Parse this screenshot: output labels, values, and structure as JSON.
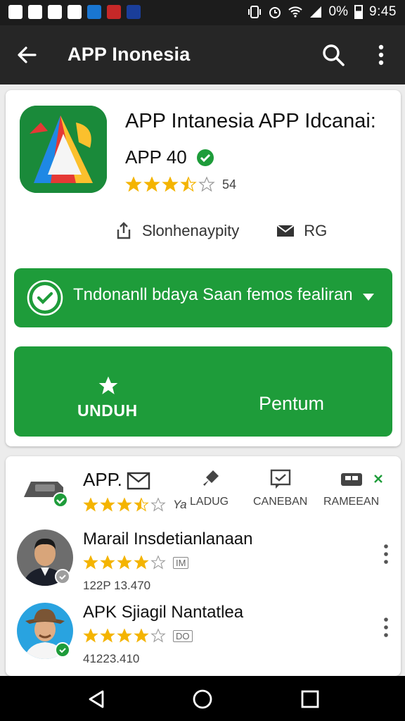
{
  "status_bar": {
    "battery_text": "0%",
    "time": "9:45"
  },
  "app_bar": {
    "title": "APP Inonesia"
  },
  "app": {
    "title": "APP Intanesia APP Idcanai:",
    "subtitle": "APP 40",
    "rating_stars": 3.5,
    "rating_count": "54",
    "meta_left": "Slonhenaypity",
    "meta_right": "RG"
  },
  "install_banner": {
    "text": "Tndonanll bdaya Saan femos fealiran"
  },
  "buttons": {
    "unduh": "UNDUH",
    "pentum": "Pentum"
  },
  "developer": {
    "title": "APP.",
    "rating_stars": 3.5,
    "rating_count": "Ya",
    "actions": [
      "LADUG",
      "CANEBAN",
      "RAMEEAN"
    ]
  },
  "reviews": [
    {
      "name": "Marail Insdetianlanaan",
      "stars": 4,
      "tag": "IM",
      "date": "122P 13.470"
    },
    {
      "name": "APK Sjiagil Nantatlea",
      "stars": 4,
      "tag": "DO",
      "date": "41223.410"
    }
  ],
  "colors": {
    "green": "#1e9c3a",
    "star": "#f4b400",
    "appbar": "#262626"
  }
}
